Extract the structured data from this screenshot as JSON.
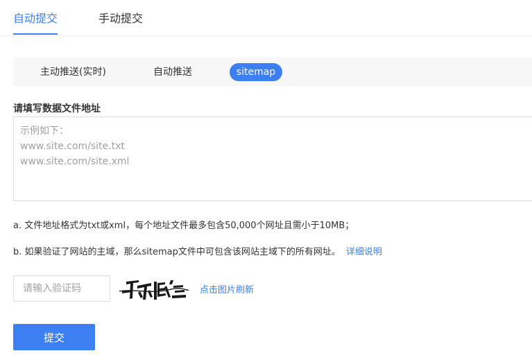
{
  "top_tabs": [
    {
      "label": "自动提交",
      "active": true
    },
    {
      "label": "手动提交",
      "active": false
    }
  ],
  "sub_tabs": [
    {
      "label": "主动推送(实时)",
      "active": false
    },
    {
      "label": "自动推送",
      "active": false
    },
    {
      "label": "sitemap",
      "active": true
    }
  ],
  "form": {
    "label": "请填写数据文件地址",
    "urls_placeholder": "示例如下：\nwww.site.com/site.txt\nwww.site.com/site.xml",
    "note_a": "a. 文件地址格式为txt或xml，每个地址文件最多包含50,000个网址且需小于10MB；",
    "note_b": "b. 如果验证了网站的主域，那么sitemap文件中可包含该网站主域下的所有网址。",
    "detail_link": "详细说明",
    "captcha_placeholder": "请输入验证码",
    "refresh_link": "点击图片刷新",
    "submit_label": "提交"
  },
  "colors": {
    "accent": "#3b7ff3"
  }
}
